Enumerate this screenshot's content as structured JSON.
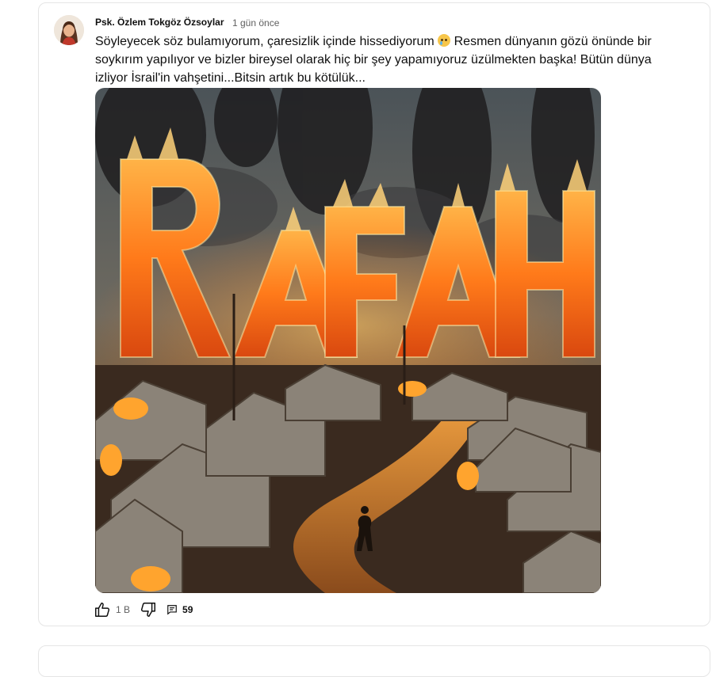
{
  "comment": {
    "author": "Psk. Özlem Tokgöz Özsoylar",
    "time": "1 gün önce",
    "text_before_emoji": "Söyleyecek söz bulamıyorum, çaresizlik içinde hissediyorum ",
    "emoji": "crying-face-emoji",
    "text_after_emoji": " Resmen dünyanın gözü önünde bir soykırım yapılıyor ve bizler bireysel olarak hiç bir şey yapamıyoruz üzülmekten başka! Bütün dünya izliyor İsrail'in vahşetini...Bitsin artık bu kötülük...",
    "image_text": "RAFAH"
  },
  "actions": {
    "like_count": "1 B",
    "reply_count": "59",
    "like_icon": "thumbs-up-icon",
    "dislike_icon": "thumbs-down-icon",
    "reply_icon": "comment-icon"
  }
}
